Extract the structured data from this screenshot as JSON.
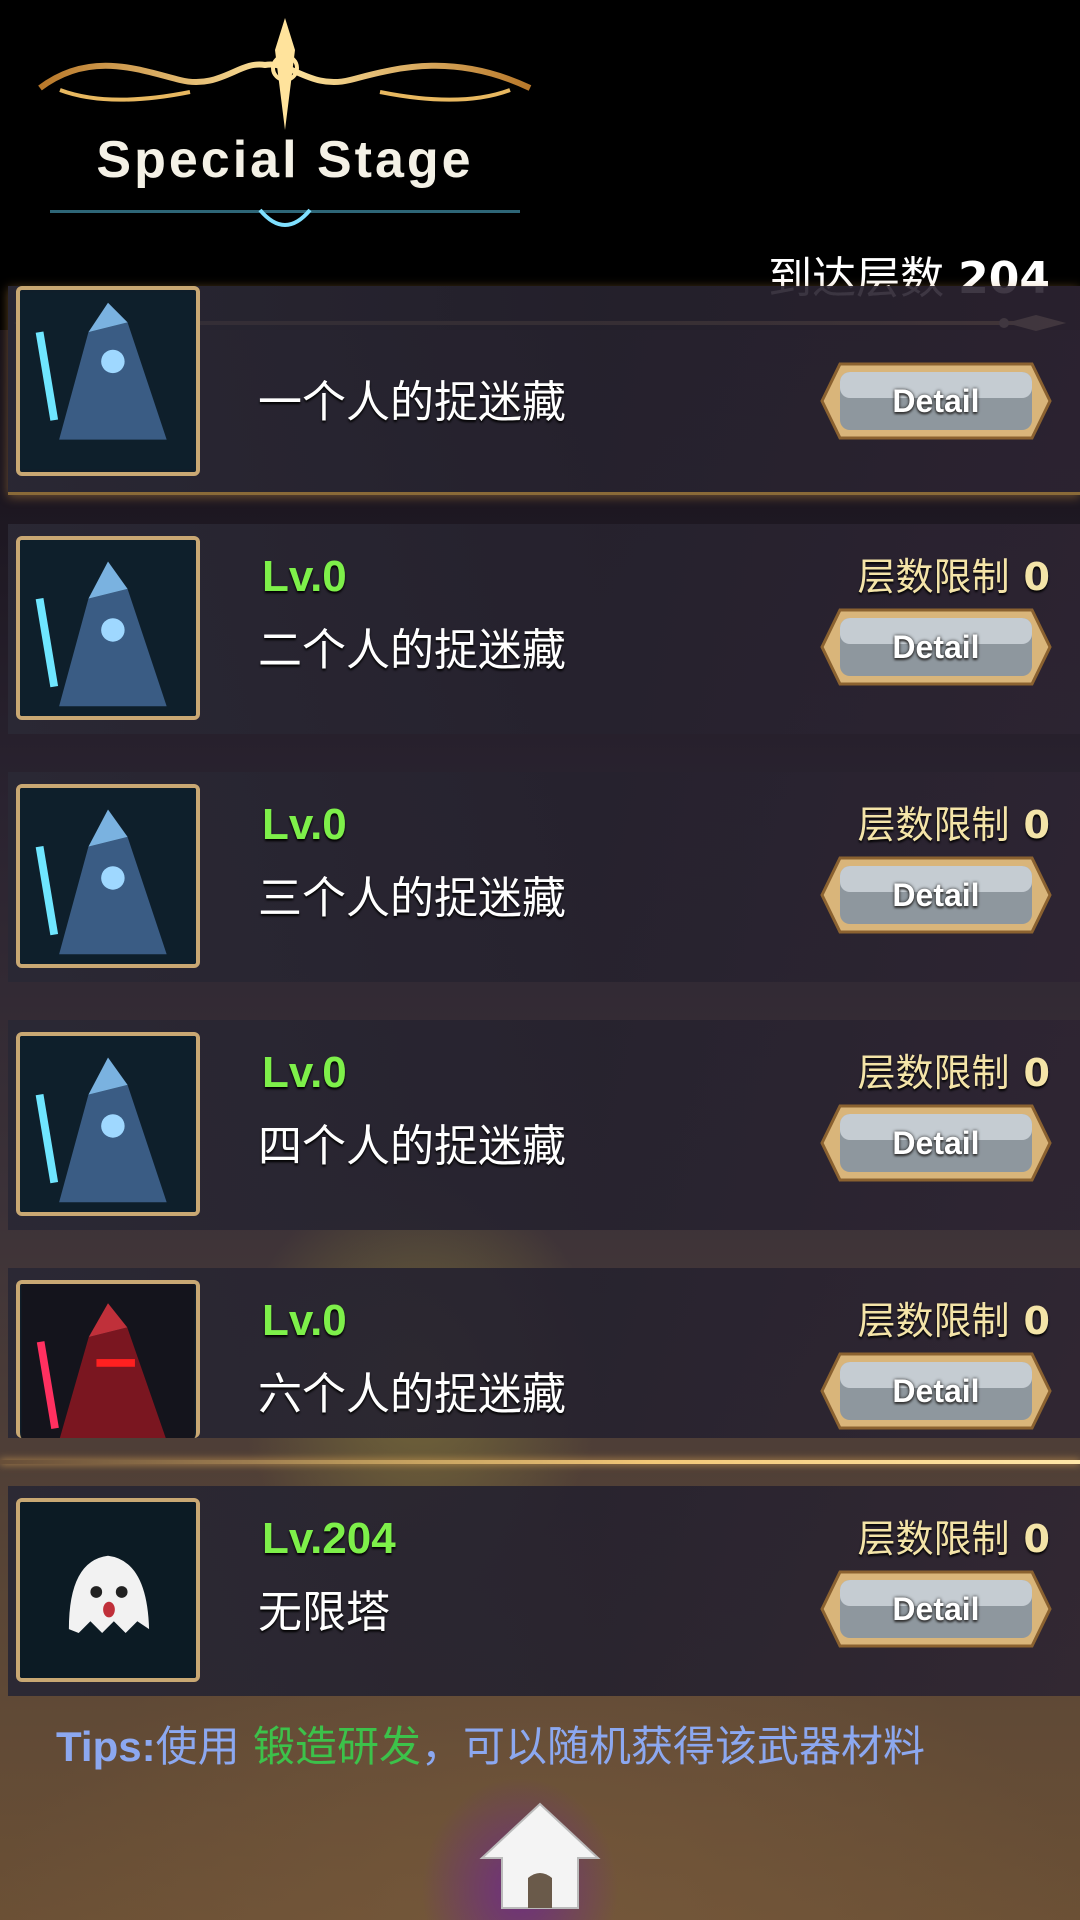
{
  "header": {
    "title": "Special Stage",
    "reach_label": "到达层数",
    "reach_value": "204"
  },
  "stages": [
    {
      "level": "",
      "name": "一个人的捉迷藏",
      "limit_label": "",
      "limit_value": "",
      "detail": "Detail",
      "portrait": "blue-knight"
    },
    {
      "level": "Lv.0",
      "name": "二个人的捉迷藏",
      "limit_label": "层数限制",
      "limit_value": "0",
      "detail": "Detail",
      "portrait": "blue-knight"
    },
    {
      "level": "Lv.0",
      "name": "三个人的捉迷藏",
      "limit_label": "层数限制",
      "limit_value": "0",
      "detail": "Detail",
      "portrait": "blue-knight"
    },
    {
      "level": "Lv.0",
      "name": "四个人的捉迷藏",
      "limit_label": "层数限制",
      "limit_value": "0",
      "detail": "Detail",
      "portrait": "blue-knight"
    },
    {
      "level": "Lv.0",
      "name": "六个人的捉迷藏",
      "limit_label": "层数限制",
      "limit_value": "0",
      "detail": "Detail",
      "portrait": "red-knight"
    },
    {
      "level": "Lv.204",
      "name": "无限塔",
      "limit_label": "层数限制",
      "limit_value": "0",
      "detail": "Detail",
      "portrait": "ghost"
    }
  ],
  "tips": {
    "tag": "Tips:",
    "before": "使用 ",
    "highlight": "锻造研发",
    "after": "，可以随机获得该武器材料"
  },
  "icons": {
    "home": "home-icon"
  },
  "colors": {
    "level": "#7ef04a",
    "limit": "#f4e4a8",
    "tips": "#8ca8f0",
    "tips_highlight": "#3cc24a",
    "frame_gold": "#c9a873"
  }
}
